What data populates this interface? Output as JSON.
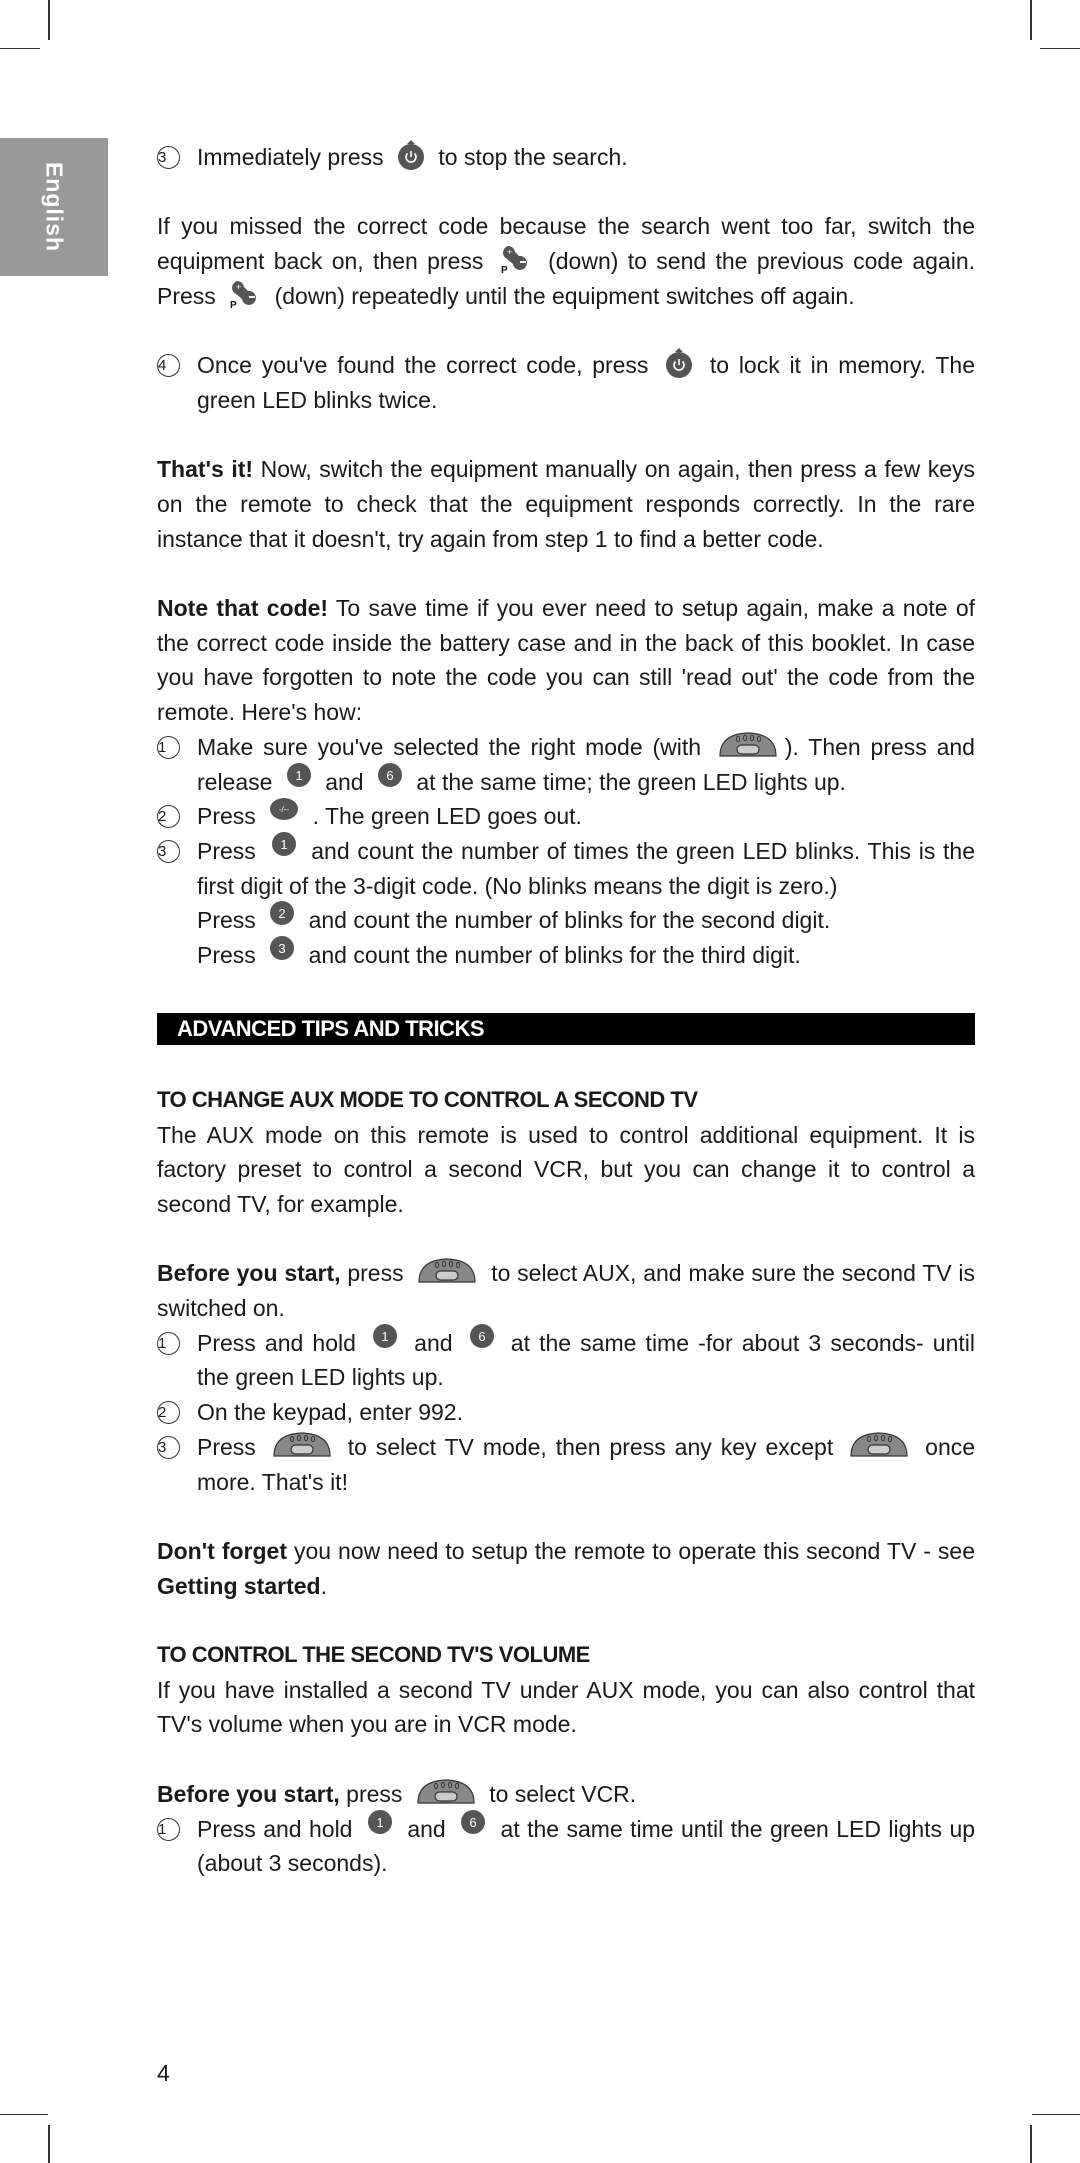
{
  "sidebar": {
    "language_tab": "English"
  },
  "step3_top": {
    "num": "3",
    "text_a": "Immediately press",
    "text_b": "to stop the search.",
    "icon": "standby-button-icon"
  },
  "missed": {
    "text_a": "If you missed the correct code because the search went too far, switch the equipment back on, then press",
    "text_b": "(down) to send the previous code again. Press",
    "text_c": "(down) repeatedly until the equipment switches off again.",
    "icon": "program-up-down-button-icon"
  },
  "step4": {
    "num": "4",
    "text_a": "Once you've found the correct code, press",
    "text_b": "to lock it in memory. The green LED blinks twice.",
    "icon": "standby-button-icon"
  },
  "thats_it": {
    "bold": "That's it!",
    "text": " Now, switch the equipment manually on again, then press a few keys on the remote to check that the equipment responds correctly. In the rare instance that it doesn't, try again from step 1 to find a better code."
  },
  "note_code": {
    "bold": "Note that code!",
    "text": " To save time if you ever need to setup again, make a note of the correct code inside the battery case and in the back of this booklet. In case you have forgotten to note the code you can still 'read out' the code from the remote. Here's how:",
    "steps": [
      {
        "num": "1",
        "text_a": "Make sure you've selected the right mode (with",
        "text_b": "). Then press and release",
        "key1": "1",
        "text_c": "and",
        "key2": "6",
        "text_d": "at the same time; the green LED lights up."
      },
      {
        "num": "2",
        "text_a": "Press",
        "key": "-/--",
        "text_b": ". The green LED goes out."
      },
      {
        "num": "3",
        "text_a": "Press",
        "key": "1",
        "text_b": "and count the number of times the green LED blinks. This is the first digit of the 3-digit code. (No blinks means the digit is zero.)"
      }
    ],
    "sub_lines": [
      {
        "text_a": "Press",
        "key": "2",
        "text_b": "and count the number of blinks for the second digit."
      },
      {
        "text_a": "Press",
        "key": "3",
        "text_b": "and count the number of blinks for the third digit."
      }
    ]
  },
  "section_bar": "ADVANCED TIPS AND TRICKS",
  "aux_section": {
    "heading": "TO CHANGE AUX MODE TO CONTROL A SECOND TV",
    "intro": "The AUX mode on this remote is used to control additional equipment. It is factory preset to control a second VCR, but you can change it to control a second TV, for example.",
    "before_bold": "Before you start,",
    "before_a": " press",
    "before_b": "to select AUX, and make sure the second TV is switched on.",
    "steps": [
      {
        "num": "1",
        "text_a": "Press and hold",
        "key1": "1",
        "text_b": "and",
        "key2": "6",
        "text_c": "at the same time -for about 3 seconds- until the green LED lights up."
      },
      {
        "num": "2",
        "text": "On the keypad, enter 992."
      },
      {
        "num": "3",
        "text_a": "Press",
        "text_b": "to select TV mode, then press any key except",
        "text_c": "once more. That's it!"
      }
    ],
    "dont_forget_bold": "Don't forget",
    "dont_forget_text": " you now need to setup the remote to operate this second TV - see ",
    "dont_forget_link": "Getting started",
    "dont_forget_end": "."
  },
  "volume_section": {
    "heading": "TO CONTROL THE SECOND TV'S VOLUME",
    "intro": "If you have installed a second TV under AUX mode, you can also control that TV's volume when you are in VCR mode.",
    "before_bold": "Before you start,",
    "before_a": " press",
    "before_b": "to select VCR.",
    "steps": [
      {
        "num": "1",
        "text_a": "Press and hold",
        "key1": "1",
        "text_b": "and",
        "key2": "6",
        "text_c": "at the same time until the green LED lights up (about 3 seconds)."
      }
    ]
  },
  "page_number": "4",
  "colors": {
    "tab_gray": "#999999",
    "bar_black": "#000000",
    "key_gray": "#555555"
  }
}
